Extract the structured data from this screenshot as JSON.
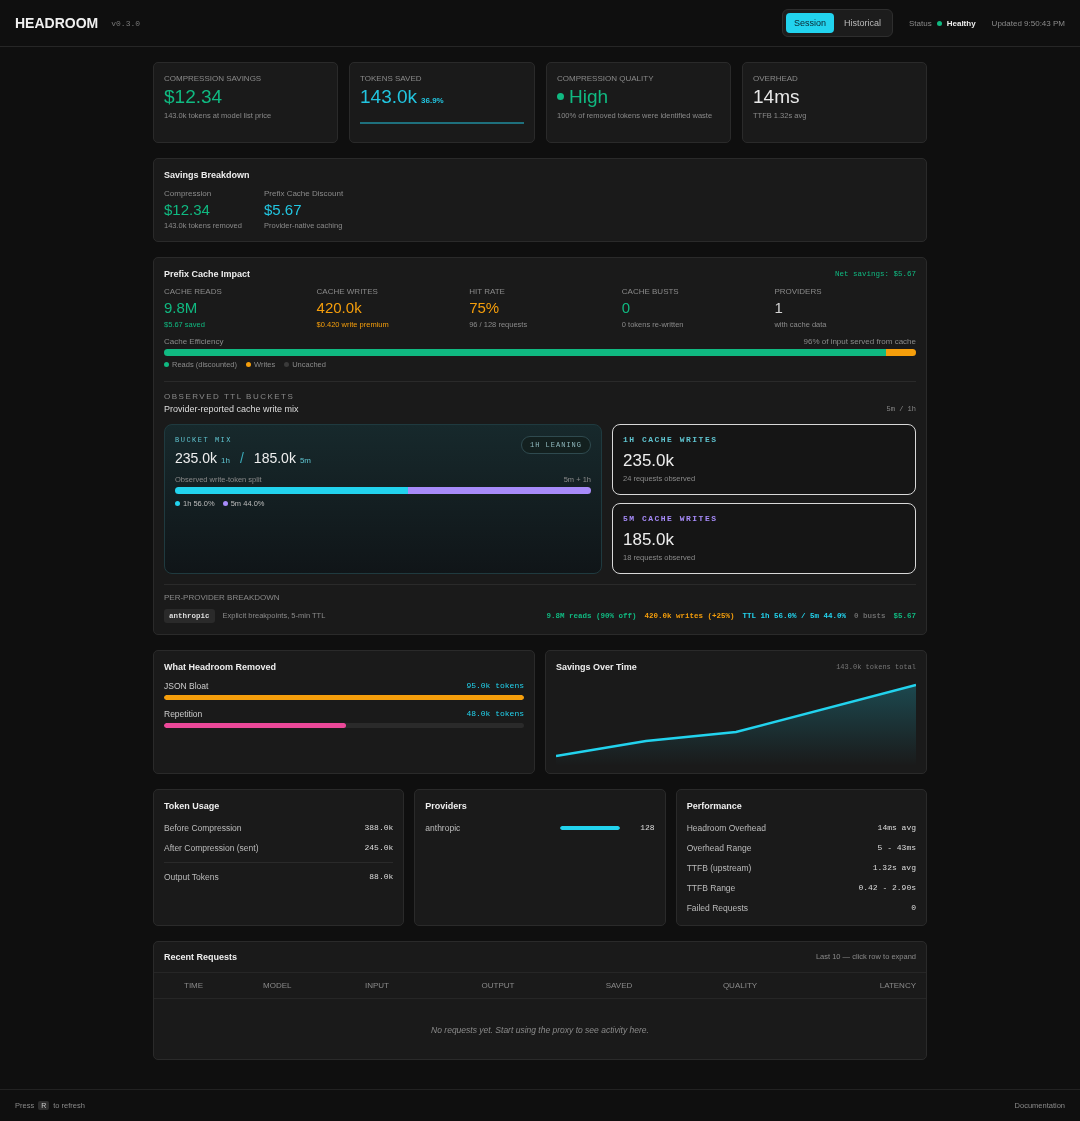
{
  "header": {
    "brand": "HEADROOM",
    "version": "v0.3.0",
    "modes": [
      {
        "label": "Session",
        "selected": true
      },
      {
        "label": "Historical",
        "selected": false
      }
    ],
    "status_label": "Status",
    "status": "Healthy",
    "updated": "Updated 9:50:43 PM"
  },
  "stats": [
    {
      "kind": "plain",
      "label": "COMPRESSION SAVINGS",
      "value": "$12.34",
      "sub": "143.0k tokens at model list price",
      "color": "#10b981"
    },
    {
      "kind": "percent",
      "label": "TOKENS SAVED",
      "value": "143.0k",
      "percent": "36.9%",
      "color": "#22c5e0"
    },
    {
      "kind": "dot",
      "label": "COMPRESSION QUALITY",
      "value": "High",
      "sub": "100% of removed tokens were identified waste",
      "color": "#10b981"
    },
    {
      "kind": "plain",
      "label": "OVERHEAD",
      "value": "14ms",
      "sub": "TTFB 1.32s avg",
      "color": "#e8e8e8"
    }
  ],
  "breakdown": {
    "title": "Savings Breakdown",
    "items": [
      {
        "label": "Compression",
        "value": "$12.34",
        "sub": "143.0k tokens removed",
        "color": "#10b981"
      },
      {
        "label": "Prefix Cache Discount",
        "value": "$5.67",
        "sub": "Provider-native caching",
        "color": "#22c5e0"
      }
    ]
  },
  "cache": {
    "title": "Prefix Cache Impact",
    "net": "Net savings: $5.67",
    "metrics": [
      {
        "label": "CACHE READS",
        "value": "9.8M",
        "sub": "$5.67 saved",
        "color": "#10b981",
        "sub_colored": true
      },
      {
        "label": "CACHE WRITES",
        "value": "420.0k",
        "sub": "$0.420 write premium",
        "color": "#f59e0b",
        "sub_colored": true
      },
      {
        "label": "HIT RATE",
        "value": "75%",
        "sub": "96 / 128 requests",
        "color": "#f59e0b",
        "sub_colored": false
      },
      {
        "label": "CACHE BUSTS",
        "value": "0",
        "sub": "0 tokens re-written",
        "color": "#10b981",
        "sub_colored": false
      },
      {
        "label": "PROVIDERS",
        "value": "1",
        "sub": "with cache data",
        "color": "#d4d4d4",
        "sub_colored": false
      }
    ],
    "efficiency_label": "Cache Efficiency",
    "efficiency_note": "96% of input served from cache",
    "segments": [
      {
        "label": "Reads (discounted)",
        "level": 0.96,
        "color": "#10b981"
      },
      {
        "label": "Writes",
        "level": 0.04,
        "color": "#f59e0b"
      },
      {
        "label": "Uncached",
        "color": "#3a3a3a"
      }
    ],
    "ttl_heading": "OBSERVED TTL BUCKETS",
    "ttl_title": "Provider-reported cache write mix",
    "ttl_note": "5m / 1h",
    "mix": {
      "label": "BUCKET MIX",
      "badge": "1H LEANING",
      "first_value": "235.0k",
      "first_unit": "1h",
      "separator": "/",
      "second_value": "185.0k",
      "second_unit": "5m",
      "split_label": "Observed write-token split",
      "split_note": "5m + 1h",
      "parts": [
        {
          "label": "1h 56.0%",
          "level": 0.56,
          "color": "#22d3ee"
        },
        {
          "label": "5m 44.0%",
          "level": 0.44,
          "color": "#a78bfa"
        }
      ]
    },
    "buckets": [
      {
        "label": "1H CACHE WRITES",
        "value": "235.0k",
        "sub": "24 requests observed",
        "color": "#5fc4d0"
      },
      {
        "label": "5M CACHE WRITES",
        "value": "185.0k",
        "sub": "18 requests observed",
        "color": "#a78bfa"
      }
    ],
    "provider_heading": "PER-PROVIDER BREAKDOWN",
    "provider": {
      "name": "anthropic",
      "note": "Explicit breakpoints, 5-min TTL",
      "stats": [
        {
          "text": "9.8M reads (90% off)",
          "color": "#10b981"
        },
        {
          "text": "420.0k writes (+25%)",
          "color": "#f59e0b"
        },
        {
          "text": "TTL 1h 56.0% / 5m 44.0%",
          "color": "#22d3ee"
        },
        {
          "text": "0 busts",
          "color": "#6b6b6b"
        },
        {
          "text": "$5.67",
          "color": "#10b981"
        }
      ]
    }
  },
  "removed": {
    "title": "What Headroom Removed",
    "items": [
      {
        "label": "JSON Bloat",
        "value": "95.0k tokens",
        "level": 1,
        "color": "#f59e0b"
      },
      {
        "label": "Repetition",
        "value": "48.0k tokens",
        "level": 0.505,
        "color": "#ec4899"
      }
    ]
  },
  "savings_chart": {
    "title": "Savings Over Time",
    "total": "143.0k tokens total"
  },
  "token_usage": {
    "title": "Token Usage",
    "rows": [
      {
        "label": "Before Compression",
        "value": "388.0k",
        "divider_above": false
      },
      {
        "label": "After Compression (sent)",
        "value": "245.0k",
        "divider_above": false
      },
      {
        "label": "Output Tokens",
        "value": "88.0k",
        "divider_above": true
      }
    ]
  },
  "providers": {
    "title": "Providers",
    "items": [
      {
        "name": "anthropic",
        "level": 1,
        "count": "128"
      }
    ]
  },
  "performance": {
    "title": "Performance",
    "rows": [
      {
        "label": "Headroom Overhead",
        "value": "14ms avg"
      },
      {
        "label": "Overhead Range",
        "value": "5 - 43ms"
      },
      {
        "label": "TTFB (upstream)",
        "value": "1.32s avg"
      },
      {
        "label": "TTFB Range",
        "value": "0.42 - 2.90s"
      },
      {
        "label": "Failed Requests",
        "value": "0"
      }
    ]
  },
  "requests": {
    "title": "Recent Requests",
    "hint": "Last 10 — click row to expand",
    "columns": [
      "TIME",
      "MODEL",
      "INPUT",
      "OUTPUT",
      "SAVED",
      "QUALITY",
      "LATENCY"
    ],
    "empty": "No requests yet. Start using the proxy to see activity here."
  },
  "footer": {
    "press": "Press",
    "key": "R",
    "refresh": "to refresh",
    "docs": "Documentation"
  }
}
